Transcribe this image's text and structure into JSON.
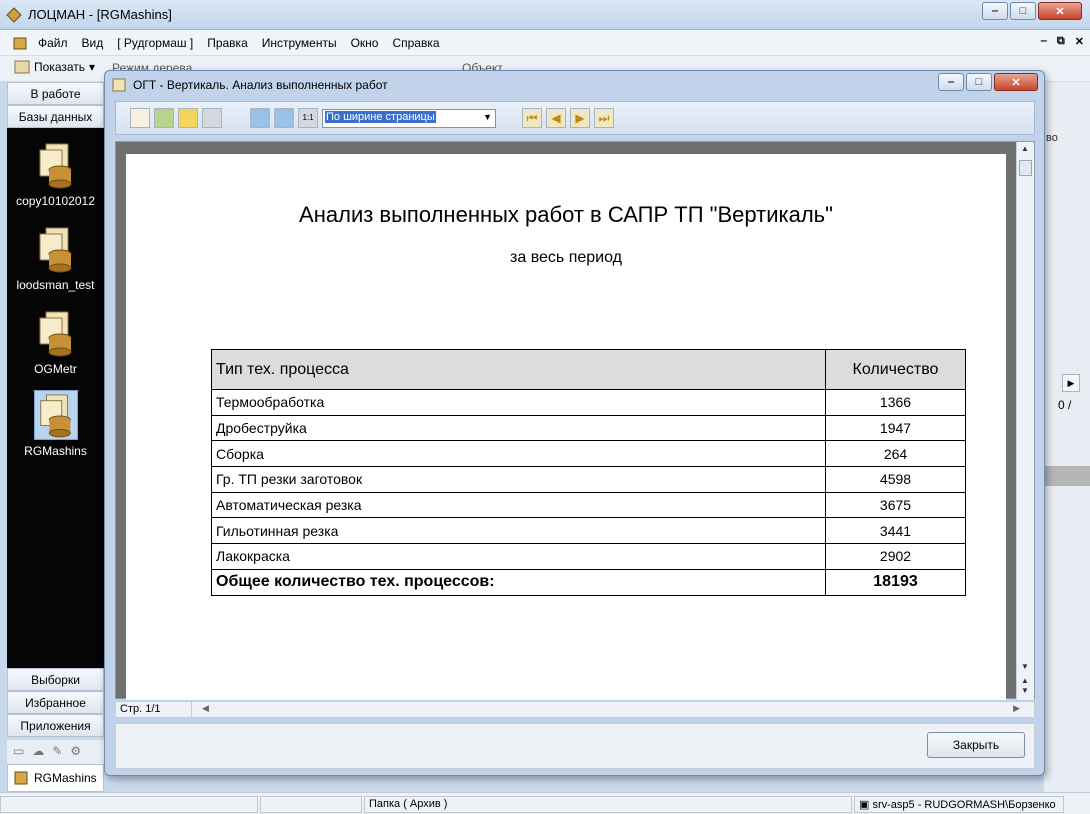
{
  "window": {
    "title": "ЛОЦМАН - [RGMashins]"
  },
  "menu": {
    "items": [
      "Файл",
      "Вид",
      "[ Рудгормаш ]",
      "Правка",
      "Инструменты",
      "Окно",
      "Справка"
    ]
  },
  "toolbar": {
    "show_label": "Показать",
    "tree_mode_label": "Режим дерева",
    "object_label": "Объект"
  },
  "nav": {
    "top_buttons": [
      "В работе",
      "Базы данных"
    ],
    "databases": [
      {
        "label": "copy10102012",
        "selected": false
      },
      {
        "label": "loodsman_test",
        "selected": false
      },
      {
        "label": "OGMetr",
        "selected": false
      },
      {
        "label": "RGMashins",
        "selected": true
      }
    ],
    "bottom_buttons": [
      "Выборки",
      "Избранное",
      "Приложения"
    ],
    "doc_tab": "RGMashins"
  },
  "background": {
    "right_text_1": "во",
    "right_text_2": "0 /"
  },
  "dialog": {
    "title": "ОГТ - Вертикаль. Анализ выполненных работ",
    "zoom_value": "По ширине страницы",
    "close_button": "Закрыть",
    "page_indicator": "Стр. 1/1"
  },
  "report": {
    "title": "Анализ выполненных работ в САПР ТП \"Вертикаль\"",
    "subtitle": "за весь период",
    "columns": [
      "Тип тех. процесса",
      "Количество"
    ],
    "rows": [
      [
        "Термообработка",
        "1366"
      ],
      [
        "Дробеструйка",
        "1947"
      ],
      [
        "Сборка",
        "264"
      ],
      [
        "Гр. ТП резки заготовок",
        "4598"
      ],
      [
        "Автоматическая резка",
        "3675"
      ],
      [
        "Гильотинная резка",
        "3441"
      ],
      [
        "Лакокраска",
        "2902"
      ]
    ],
    "total": [
      "Общее количество тех. процессов:",
      "18193"
    ]
  },
  "statusbar": {
    "folder": "Папка ( Архив )",
    "server": "srv-asp5 - RUDGORMASH\\Борзенко"
  }
}
